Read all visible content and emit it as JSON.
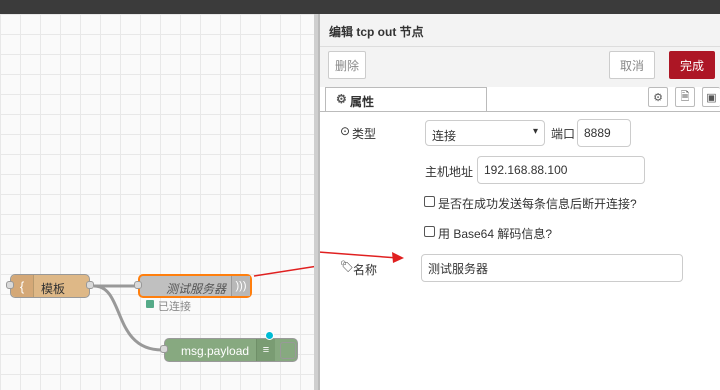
{
  "flow": {
    "nodes": {
      "template": "模板",
      "tcp_out": "测试服务器",
      "tcp_status": "已连接",
      "debug": "msg.payload"
    },
    "colors": {
      "template": "#deb887",
      "tcp": "#c0c0c0",
      "debug": "#87a980",
      "status_dot": "#5a8"
    }
  },
  "editor": {
    "title": "编辑 tcp out 节点",
    "toolbar": {
      "delete_label": "删除",
      "cancel_label": "取消",
      "done_label": "完成"
    },
    "tabs": {
      "properties_label": "属性"
    },
    "form": {
      "type_label": "类型",
      "type_value": "连接",
      "port_label": "端口",
      "port_value": "8889",
      "host_label": "主机地址",
      "host_value": "192.168.88.100",
      "close_after_send_label": "是否在成功发送每条信息后断开连接?",
      "base64_label": "用 Base64 解码信息?",
      "name_label": "名称",
      "name_value": "测试服务器"
    },
    "colors": {
      "accent": "#ad1625"
    }
  }
}
